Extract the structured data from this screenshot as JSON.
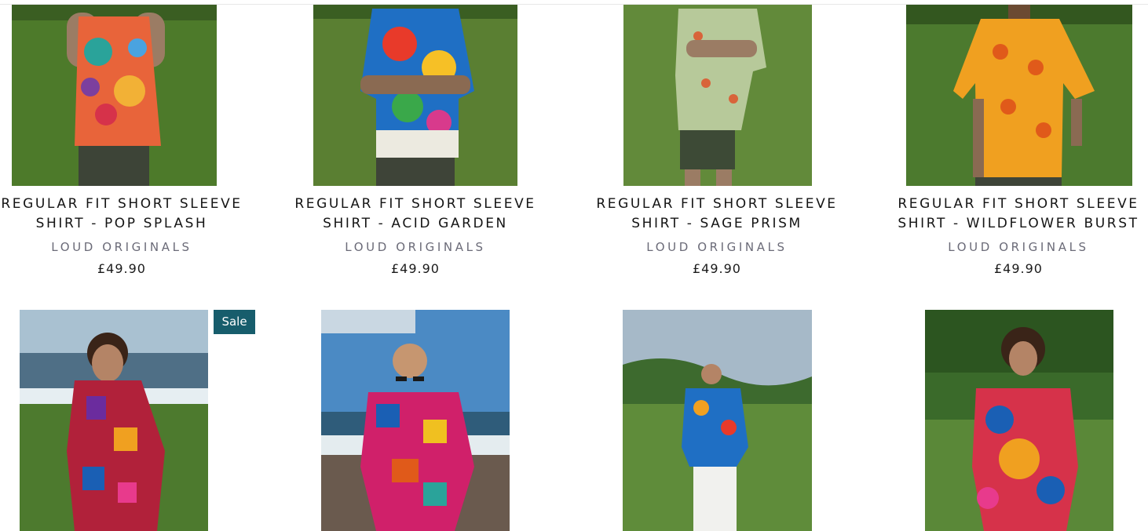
{
  "products": [
    {
      "title_line1": "Regular Fit Short Sleeve",
      "title_line2": "Shirt - Pop Splash",
      "vendor": "LOUD ORIGINALS",
      "price": "£49.90"
    },
    {
      "title_line1": "Regular Fit Short Sleeve",
      "title_line2": "Shirt - Acid Garden",
      "vendor": "LOUD ORIGINALS",
      "price": "£49.90"
    },
    {
      "title_line1": "Regular Fit Short Sleeve",
      "title_line2": "Shirt - Sage Prism",
      "vendor": "LOUD ORIGINALS",
      "price": "£49.90"
    },
    {
      "title_line1": "Regular Fit Short Sleeve",
      "title_line2": "Shirt - Wildflower Burst",
      "vendor": "LOUD ORIGINALS",
      "price": "£49.90"
    }
  ],
  "second_row_badge": "Sale",
  "colors": {
    "sale_badge": "#175d6c",
    "title_text": "#141414",
    "vendor_text": "#6b6b78"
  }
}
